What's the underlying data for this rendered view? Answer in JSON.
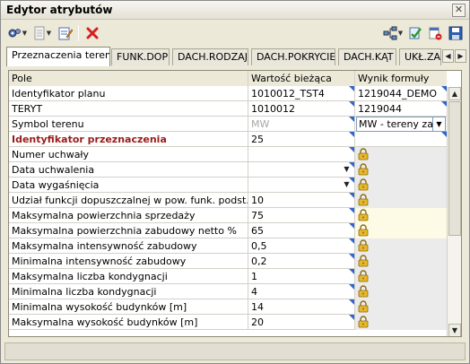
{
  "window": {
    "title": "Edytor atrybutów",
    "close_glyph": "✕"
  },
  "toolbar": {
    "left": [
      {
        "name": "settings-gear-icon",
        "dropdown": true
      },
      {
        "name": "document-icon",
        "dropdown": true
      },
      {
        "name": "edit-form-icon",
        "dropdown": false
      },
      {
        "name": "delete-x-icon",
        "dropdown": false
      }
    ],
    "right": [
      {
        "name": "network-tree-icon",
        "dropdown": true
      },
      {
        "name": "validate-check-icon",
        "dropdown": false
      },
      {
        "name": "exit-icon",
        "dropdown": false
      },
      {
        "name": "save-disk-icon",
        "dropdown": false
      }
    ]
  },
  "tabs": [
    {
      "label": "Przeznaczenia terenu",
      "active": true
    },
    {
      "label": "FUNK.DOP",
      "active": false
    },
    {
      "label": "DACH.RODZAJ",
      "active": false
    },
    {
      "label": "DACH.POKRYCIE",
      "active": false
    },
    {
      "label": "DACH.KĄT",
      "active": false
    },
    {
      "label": "UKŁ.ZA",
      "active": false
    }
  ],
  "tab_arrows": {
    "left": "◀",
    "right": "▶"
  },
  "grid": {
    "headers": {
      "field": "Pole",
      "value": "Wartość bieżąca",
      "formula": "Wynik formuły"
    },
    "rows": [
      {
        "field": "Identyfikator planu",
        "value": "1010012_TST4",
        "formula": "1219044_DEMO",
        "style": "normal",
        "lock": false,
        "dropdown": false
      },
      {
        "field": "TERYT",
        "value": "1010012",
        "formula": "1219044",
        "style": "normal",
        "lock": false,
        "dropdown": false
      },
      {
        "field": "Symbol terenu",
        "value": "MW",
        "formula": "MW - tereny zabu",
        "style": "combo",
        "lock": false,
        "dropdown": false
      },
      {
        "field": "Identyfikator przeznaczenia",
        "value": "25",
        "formula": "",
        "style": "bold",
        "lock": false,
        "dropdown": false
      },
      {
        "field": "Numer uchwały",
        "value": "",
        "formula": "",
        "style": "gray",
        "lock": true,
        "dropdown": false
      },
      {
        "field": "Data uchwalenia",
        "value": "",
        "formula": "",
        "style": "gray",
        "lock": true,
        "dropdown": true
      },
      {
        "field": "Data wygaśnięcia",
        "value": "",
        "formula": "",
        "style": "gray",
        "lock": true,
        "dropdown": true
      },
      {
        "field": "Udział funkcji dopuszczalnej w pow. funk. podst. [%]",
        "value": "10",
        "formula": "",
        "style": "gray",
        "lock": true,
        "dropdown": false
      },
      {
        "field": "Maksymalna powierzchnia sprzedaży",
        "value": "75",
        "formula": "",
        "style": "yellow",
        "lock": true,
        "dropdown": false
      },
      {
        "field": "Maksymalna powierzchnia zabudowy netto %",
        "value": "65",
        "formula": "",
        "style": "yellow",
        "lock": true,
        "dropdown": false
      },
      {
        "field": "Maksymalna intensywność zabudowy",
        "value": "0,5",
        "formula": "",
        "style": "gray",
        "lock": true,
        "dropdown": false
      },
      {
        "field": "Minimalna intensywność zabudowy",
        "value": "0,2",
        "formula": "",
        "style": "gray",
        "lock": true,
        "dropdown": false
      },
      {
        "field": "Maksymalna liczba kondygnacji",
        "value": "1",
        "formula": "",
        "style": "gray",
        "lock": true,
        "dropdown": false
      },
      {
        "field": "Minimalna liczba kondygnacji",
        "value": "4",
        "formula": "",
        "style": "gray",
        "lock": true,
        "dropdown": false
      },
      {
        "field": "Minimalna wysokość budynków [m]",
        "value": "14",
        "formula": "",
        "style": "gray",
        "lock": true,
        "dropdown": false
      },
      {
        "field": "Maksymalna wysokość budynków [m]",
        "value": "20",
        "formula": "",
        "style": "gray",
        "lock": true,
        "dropdown": false
      }
    ]
  },
  "scrollbar": {
    "up": "▲",
    "down": "▼"
  },
  "colors": {
    "accent_blue": "#3366cc",
    "lock_gold": "#d9a520",
    "delete_red": "#d42020",
    "bold_label": "#9b1b1b"
  }
}
